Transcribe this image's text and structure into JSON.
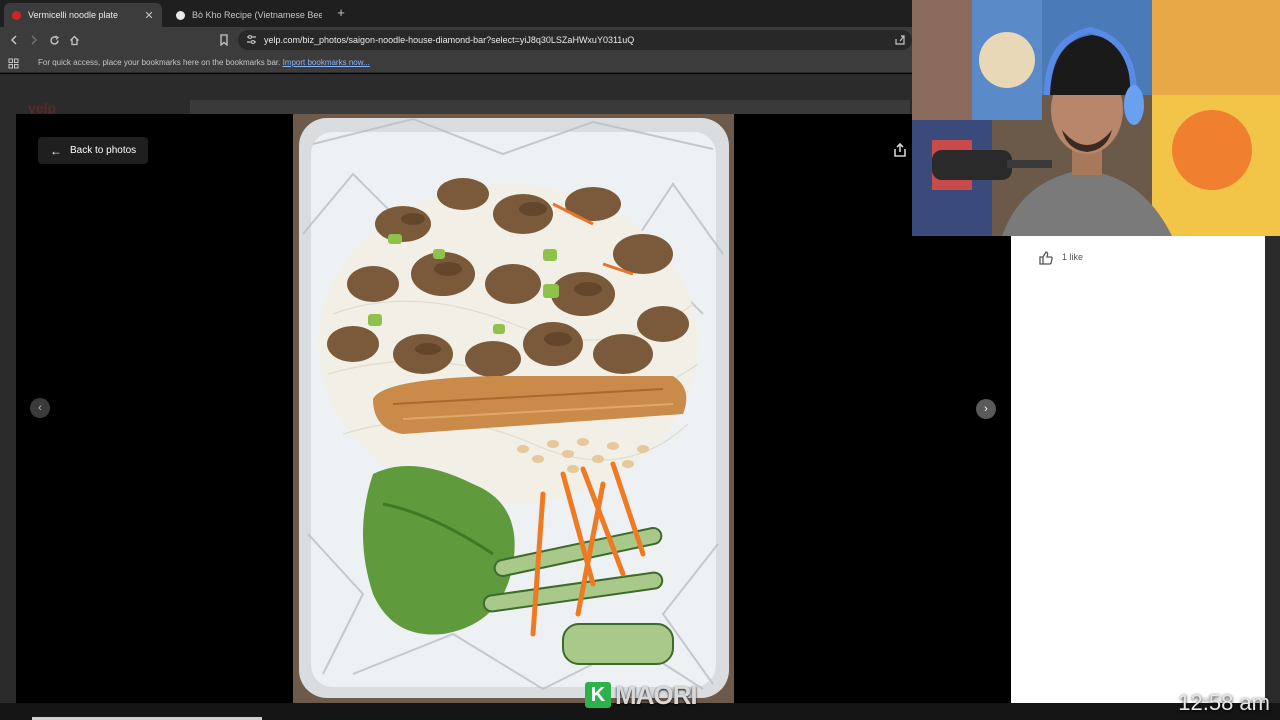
{
  "browser": {
    "tabs": [
      {
        "title": "Vermicelli noodle plate",
        "active": true,
        "favicon_color": "#d32323"
      },
      {
        "title": "Bò Kho Recipe (Vietnamese Beef Ste...",
        "active": false,
        "favicon_color": "#e8e8e8"
      }
    ],
    "new_tab_icon": "plus-icon",
    "url": "yelp.com/biz_photos/saigon-noodle-house-diamond-bar?select=yiJ8q30LSZaHWxuY0311uQ",
    "bookmarks_bar": {
      "message": "For quick access, place your bookmarks here on the bookmarks bar.",
      "import_link": "Import bookmarks now..."
    }
  },
  "page": {
    "logo_text": "yelp"
  },
  "modal": {
    "back_label": "Back to photos",
    "photo_alt": "Vermicelli noodle plate with grilled pork, egg roll, peanuts and vegetables",
    "likes_label": "1 like",
    "like_count": 1
  },
  "overlay": {
    "watermark_letter": "K",
    "watermark_text": "MAORI",
    "clock": "12:58 am"
  },
  "colors": {
    "yelp_red": "#d32323",
    "modal_bg": "#000000",
    "panel_bg": "#ffffff",
    "watermark_green": "#2bb24c"
  }
}
